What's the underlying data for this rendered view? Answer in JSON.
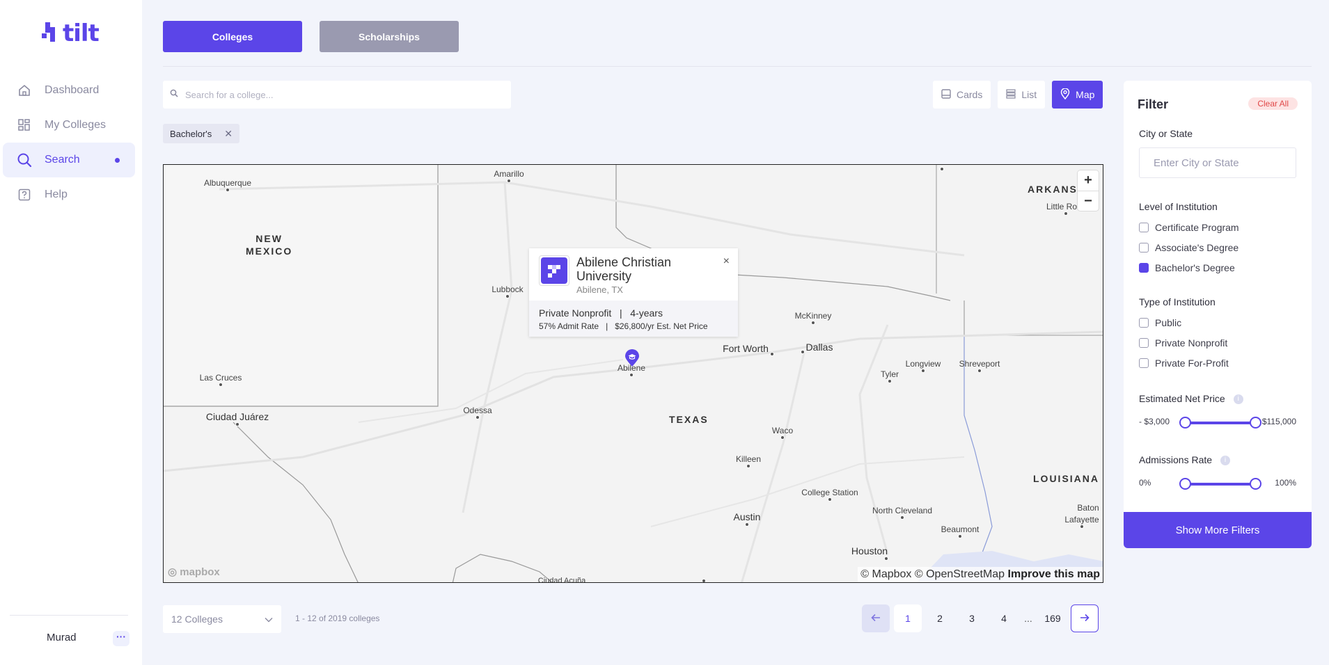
{
  "app": {
    "brand": "tilt"
  },
  "sidebar": {
    "items": [
      {
        "label": "Dashboard",
        "icon": "home-icon"
      },
      {
        "label": "My Colleges",
        "icon": "grid-icon"
      },
      {
        "label": "Search",
        "icon": "search-icon",
        "active": true
      },
      {
        "label": "Help",
        "icon": "help-icon"
      }
    ],
    "user": {
      "name": "Murad",
      "more": "···"
    }
  },
  "tabs": {
    "colleges": "Colleges",
    "scholarships": "Scholarships"
  },
  "search": {
    "placeholder": "Search for a college..."
  },
  "views": {
    "cards": "Cards",
    "list": "List",
    "map": "Map",
    "active": "Map"
  },
  "chips": [
    {
      "label": "Bachelor's"
    }
  ],
  "map": {
    "regions": {
      "new_mexico": "NEW\nMEXICO",
      "texas": "TEXAS",
      "louisiana": "LOUISIANA",
      "arkansas": "ARKANS"
    },
    "places": {
      "albuquerque": "Albuquerque",
      "amarillo": "Amarillo",
      "lubbock": "Lubbock",
      "las_cruces": "Las Cruces",
      "ciudad_juarez": "Ciudad Juárez",
      "odessa": "Odessa",
      "abilene": "Abilene",
      "fort_worth": "Fort Worth",
      "dallas": "Dallas",
      "mckinney": "McKinney",
      "tyler": "Tyler",
      "longview": "Longview",
      "shreveport": "Shreveport",
      "waco": "Waco",
      "killeen": "Killeen",
      "college_station": "College Station",
      "austin": "Austin",
      "north_cleveland": "North Cleveland",
      "beaumont": "Beaumont",
      "houston": "Houston",
      "baton": "Baton",
      "lafayette": "Lafayette",
      "little_rock": "Little Ro",
      "ciudad_acuna": "Ciudad Acuña"
    },
    "zoom_in": "+",
    "zoom_out": "−",
    "attribution": {
      "mapbox": "© Mapbox",
      "osm": "© OpenStreetMap",
      "improve": "Improve this map"
    },
    "logo": "mapbox"
  },
  "popup": {
    "name": "Abilene Christian University",
    "location": "Abilene, TX",
    "type": "Private Nonprofit",
    "separator": "|",
    "length": "4-years",
    "admit": "57% Admit Rate",
    "price": "$26,800/yr Est. Net Price",
    "close": "×"
  },
  "filter": {
    "title": "Filter",
    "clear": "Clear All",
    "city_label": "City or State",
    "city_placeholder": "Enter City or State",
    "level_label": "Level of Institution",
    "levels": [
      {
        "label": "Certificate Program",
        "checked": false
      },
      {
        "label": "Associate's Degree",
        "checked": false
      },
      {
        "label": "Bachelor's Degree",
        "checked": true
      }
    ],
    "type_label": "Type of Institution",
    "types": [
      {
        "label": "Public",
        "checked": false
      },
      {
        "label": "Private Nonprofit",
        "checked": false
      },
      {
        "label": "Private For-Profit",
        "checked": false
      }
    ],
    "price_label": "Estimated Net Price",
    "price_min": "- $3,000",
    "price_max": "$115,000",
    "admit_label": "Admissions Rate",
    "admit_min": "0%",
    "admit_max": "100%",
    "more": "Show More Filters"
  },
  "footer": {
    "per_page": "12 Colleges",
    "range": "1 - 12 of 2019 colleges",
    "pages": [
      "1",
      "2",
      "3",
      "4"
    ],
    "ellipsis": "...",
    "last": "169",
    "current": "1"
  },
  "colors": {
    "accent": "#5b45e8",
    "danger": "#e04848"
  }
}
